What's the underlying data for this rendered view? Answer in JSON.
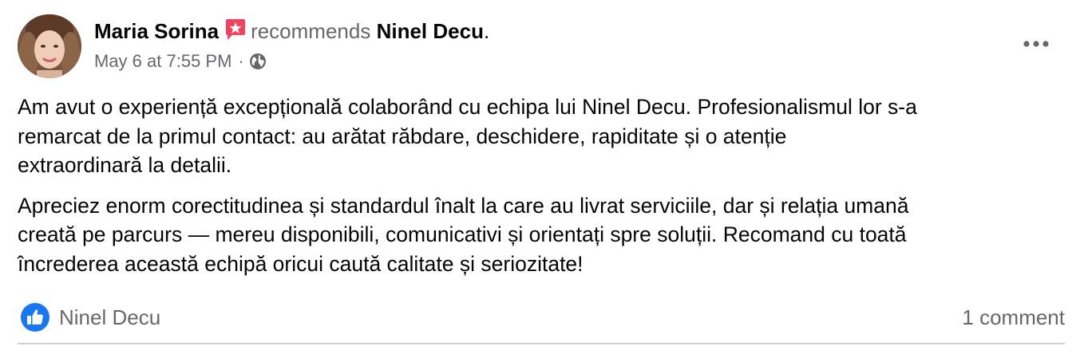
{
  "post": {
    "author": "Maria Sorina",
    "verb": "recommends",
    "page": "Ninel Decu",
    "period": ".",
    "timestamp": "May 6 at 7:55 PM",
    "separator": "·",
    "paragraphs": [
      "Am avut o experiență excepțională colaborând cu echipa lui Ninel Decu. Profesionalismul lor s-a\nremarcat de la primul contact: au arătat răbdare, deschidere, rapiditate și o atenție\nextraordinară la detalii.",
      "Apreciez enorm corectitudinea și standardul înalt la care au livrat serviciile, dar și relația umană\ncreată pe parcurs — mereu disponibili, comunicativi și orientați spre soluții. Recomand cu toată\nîncrederea această echipă oricui caută calitate și seriozitate!"
    ],
    "reactions": {
      "icon": "like-icon",
      "names": "Ninel Decu"
    },
    "comments": "1 comment"
  },
  "icons": {
    "recommend_badge": "recommend-star-icon",
    "audience": "globe-icon",
    "more": "more-options-icon"
  },
  "colors": {
    "text_primary": "#050505",
    "text_secondary": "#65676b",
    "like_blue": "#1877f2",
    "recommend_pink": "#f3425f",
    "divider": "#ced0d4"
  }
}
